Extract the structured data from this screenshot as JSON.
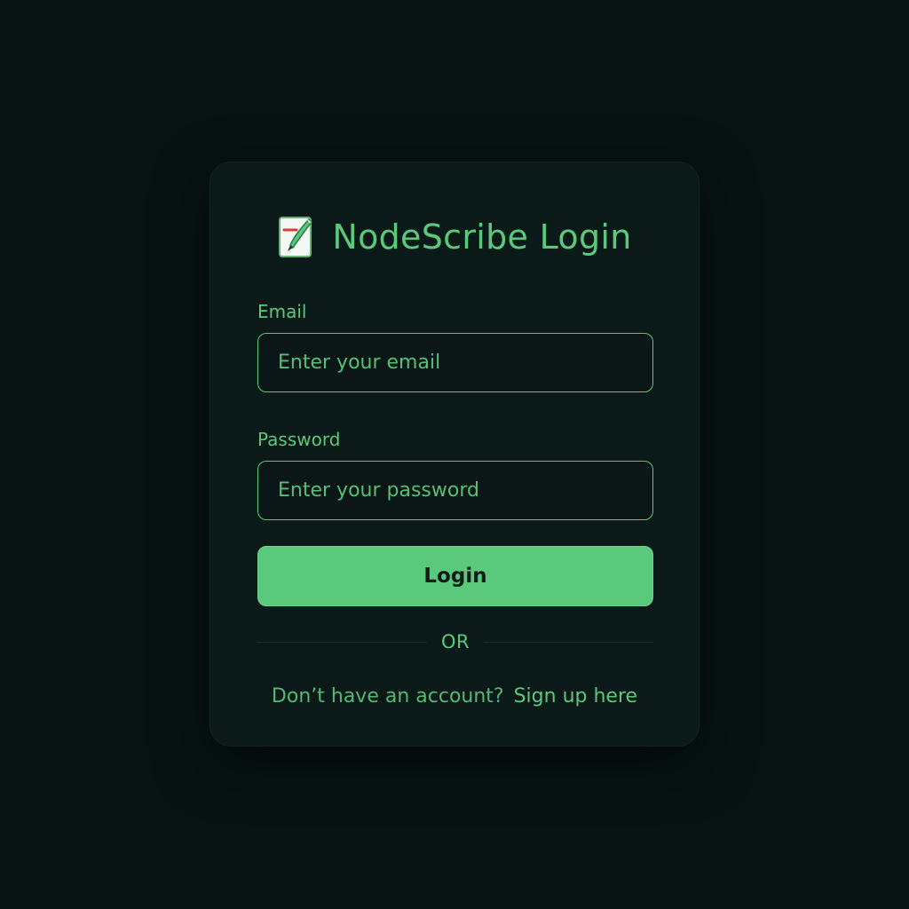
{
  "header": {
    "title": "NodeScribe Login",
    "logo_icon": "pen-and-paper-icon"
  },
  "form": {
    "email": {
      "label": "Email",
      "value": "",
      "placeholder": "Enter your email"
    },
    "password": {
      "label": "Password",
      "value": "",
      "placeholder": "Enter your password"
    },
    "login_label": "Login",
    "divider_text": "OR"
  },
  "footer": {
    "prompt": "Don’t have an account?",
    "signup_label": "Sign up here"
  },
  "colors": {
    "background": "#061312",
    "card": "#0b1a19",
    "accent": "#5bc97c",
    "button_text": "#0c1c18"
  }
}
